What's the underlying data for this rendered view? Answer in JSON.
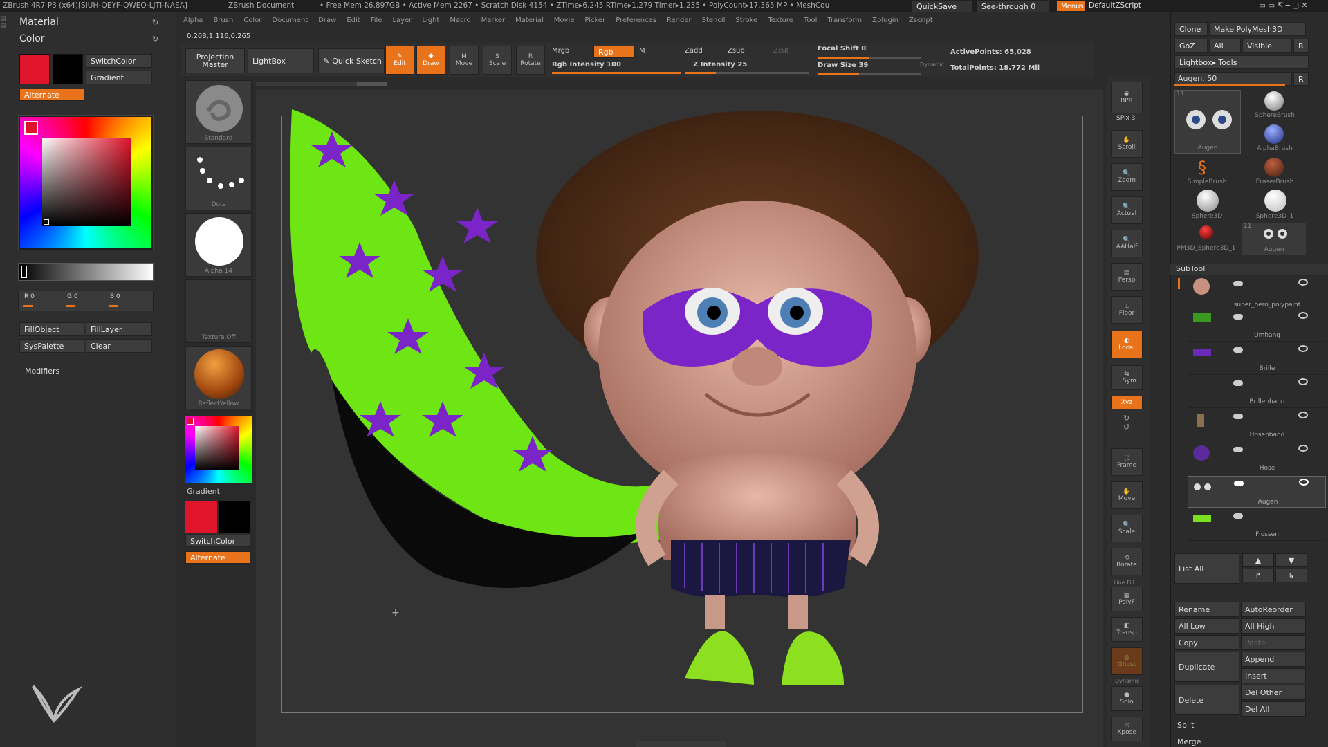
{
  "title_bar": {
    "app": "ZBrush 4R7 P3 (x64)[SIUH-QEYF-QWEO-LJTI-NAEA]",
    "doc": "ZBrush Document",
    "stats": "• Free Mem 26.897GB • Active Mem 2267 • Scratch Disk 4154 • ZTime▸6.245 RTime▸1.279 Timer▸1.235 • PolyCount▸17.365 MP • MeshCou",
    "quicksave": "QuickSave",
    "see_through": "See-through  0",
    "menus": "Menus",
    "zscript": "DefaultZScript"
  },
  "menus": [
    "Alpha",
    "Brush",
    "Color",
    "Document",
    "Draw",
    "Edit",
    "File",
    "Layer",
    "Light",
    "Macro",
    "Marker",
    "Material",
    "Movie",
    "Picker",
    "Preferences",
    "Render",
    "Stencil",
    "Stroke",
    "Texture",
    "Tool",
    "Transform",
    "Zplugin",
    "Zscript"
  ],
  "coords": "0.208,1.116,0.265",
  "left_panel": {
    "material": "Material",
    "color": "Color",
    "switch_color": "SwitchColor",
    "gradient": "Gradient",
    "alternate": "Alternate",
    "r": "R 0",
    "g": "G 0",
    "b": "B 0",
    "fill_object": "FillObject",
    "fill_layer": "FillLayer",
    "sys_palette": "SysPalette",
    "clear": "Clear",
    "modifiers": "Modifiers",
    "main_color": "#e0142a",
    "secondary_color": "#000000"
  },
  "shelf": {
    "projection_master": "Projection Master",
    "lightbox": "LightBox",
    "quick_sketch": "Quick Sketch",
    "edit": "Edit",
    "draw": "Draw",
    "move": "Move",
    "scale": "Scale",
    "rotate": "Rotate",
    "mrgb": "Mrgb",
    "rgb": "Rgb",
    "m": "M",
    "rgb_intensity": "Rgb Intensity 100",
    "zadd": "Zadd",
    "zsub": "Zsub",
    "zcut": "Zcut",
    "z_intensity": "Z Intensity 25",
    "focal_shift": "Focal Shift 0",
    "draw_size": "Draw Size 39",
    "dynamic": "Dynamic",
    "active_points": "ActivePoints: 65,028",
    "total_points": "TotalPoints: 18.772 Mil"
  },
  "tool_strip": {
    "standard": "Standard",
    "dots": "Dots",
    "alpha": "Alpha 14",
    "texture": "Texture Off",
    "material": "ReflectYellow",
    "gradient": "Gradient",
    "switch_color": "SwitchColor",
    "alternate": "Alternate"
  },
  "right_strip": [
    "BPR",
    "SPix 3",
    "Scroll",
    "Zoom",
    "Actual",
    "AAHalf",
    "Persp",
    "Floor",
    "Local",
    "L.Sym",
    "Xyz",
    "Frame",
    "Move",
    "Scale",
    "Rotate",
    "PolyF",
    "Transp",
    "Ghost",
    "Solo",
    "Xpose"
  ],
  "right_strip_extra": {
    "dynamic": "Dynamic",
    "line_fill": "Line Fill"
  },
  "right_panel": {
    "clone": "Clone",
    "make_polymesh": "Make PolyMesh3D",
    "goz": "GoZ",
    "all": "All",
    "visible": "Visible",
    "r": "R",
    "lightbox_tools": "Lightbox▸ Tools",
    "augen": "Augen. 50",
    "tools": [
      "Augen",
      "SphereBrush",
      "AlphaBrush",
      "SimpleBrush",
      "EraserBrush",
      "Sphere3D",
      "Sphere3D_1",
      "PM3D_Sphere3D_1",
      "Augen"
    ],
    "tool_counts": [
      "11",
      "11"
    ],
    "subtool_header": "SubTool",
    "subtools": [
      "super_hero_polypaint",
      "Umhang",
      "Brille",
      "Brillenband",
      "Hosenband",
      "Hose",
      "Augen",
      "Flossen"
    ],
    "list_all": "List  All",
    "rename": "Rename",
    "auto_reorder": "AutoReorder",
    "all_low": "All Low",
    "all_high": "All High",
    "copy": "Copy",
    "paste": "Paste",
    "duplicate": "Duplicate",
    "append": "Append",
    "insert": "Insert",
    "delete": "Delete",
    "del_other": "Del Other",
    "del_all": "Del All",
    "split": "Split",
    "merge": "Merge"
  },
  "colors": {
    "accent": "#e8731a",
    "panel": "#2e2e2e",
    "canvas": "#333333"
  }
}
